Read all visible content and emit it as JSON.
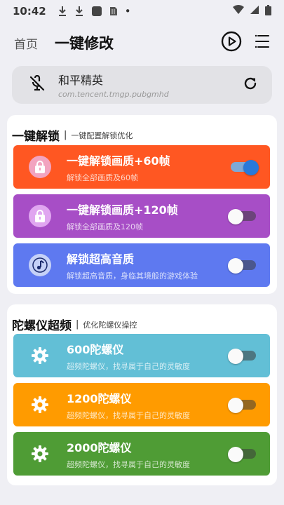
{
  "status_bar": {
    "time": "10:42",
    "dot": "•",
    "icons": [
      "download-icon",
      "download-icon",
      "app-notification-icon",
      "sim-icon",
      "wifi-icon",
      "signal-icon",
      "battery-icon"
    ]
  },
  "header": {
    "home_label": "首页",
    "title": "一键修改",
    "icons": [
      "play-circle-icon",
      "menu-icon"
    ]
  },
  "app": {
    "name": "和平精英",
    "package": "com.tencent.tmgp.pubgmhd",
    "icons": [
      "muted-mic-icon",
      "refresh-icon"
    ]
  },
  "sections": [
    {
      "title": "一键解锁",
      "separator": "|",
      "subtitle": "一键配置解锁优化",
      "items": [
        {
          "title": "一键解锁画质+60帧",
          "desc": "解锁全部画质及60帧",
          "color": "#ff5722",
          "icon_bg": "#f5a3c0",
          "icon": "lock-icon",
          "on": true
        },
        {
          "title": "一键解锁画质+120帧",
          "desc": "解锁全部画质及120帧",
          "color": "#a74ec6",
          "icon_bg": "#e0a6f0",
          "icon": "lock-icon",
          "on": false
        },
        {
          "title": "解锁超高音质",
          "desc": "解锁超高音质，身临其境般的游戏体验",
          "color": "#5e79f0",
          "icon_bg": "#c5d1f7",
          "icon": "music-note-icon",
          "on": false
        }
      ]
    },
    {
      "title": "陀螺仪超频",
      "separator": "|",
      "subtitle": "优化陀螺仪操控",
      "items": [
        {
          "title": "600陀螺仪",
          "desc": "超频陀螺仪，找寻属于自己的灵敏度",
          "color": "#62bfd6",
          "icon_bg": "#62bfd6",
          "icon": "gear-icon",
          "on": false
        },
        {
          "title": "1200陀螺仪",
          "desc": "超频陀螺仪，找寻属于自己的灵敏度",
          "color": "#ff9b00",
          "icon_bg": "#ff9b00",
          "icon": "gear-icon",
          "on": false
        },
        {
          "title": "2000陀螺仪",
          "desc": "超频陀螺仪，找寻属于自己的灵敏度",
          "color": "#4f9c35",
          "icon_bg": "#4f9c35",
          "icon": "gear-icon",
          "on": false
        }
      ]
    }
  ]
}
